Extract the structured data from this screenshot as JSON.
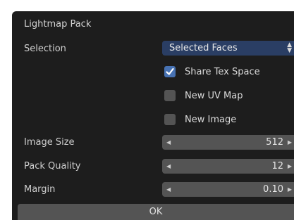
{
  "dialog": {
    "title": "Lightmap Pack",
    "selection": {
      "label": "Selection",
      "value": "Selected Faces"
    },
    "checkboxes": [
      {
        "label": "Share Tex Space",
        "checked": true
      },
      {
        "label": "New UV Map",
        "checked": false
      },
      {
        "label": "New Image",
        "checked": false
      }
    ],
    "fields": [
      {
        "label": "Image Size",
        "value": "512"
      },
      {
        "label": "Pack Quality",
        "value": "12"
      },
      {
        "label": "Margin",
        "value": "0.10"
      }
    ],
    "ok_label": "OK"
  },
  "colors": {
    "background": "#1d1d1d",
    "select_bg": "#2a3e64",
    "field_bg": "#545454",
    "checkbox_on": "#4772b3"
  }
}
